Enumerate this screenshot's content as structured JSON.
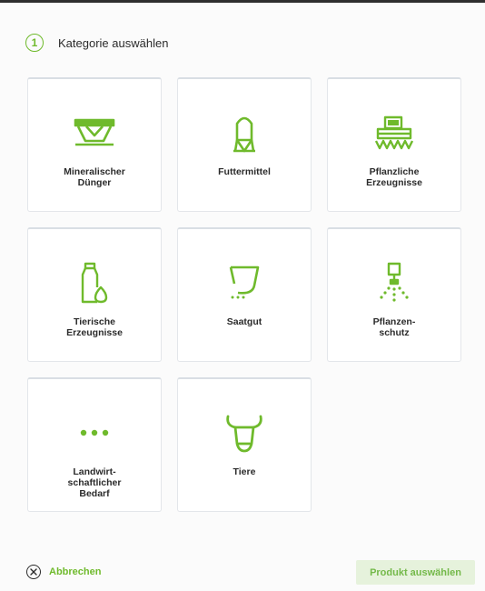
{
  "header": {
    "step_number": "1",
    "title": "Kategorie auswählen"
  },
  "categories": [
    {
      "label": "Mineralischer\nDünger",
      "icon": "fertilizer-spreader-icon"
    },
    {
      "label": "Futtermittel",
      "icon": "feed-silo-icon"
    },
    {
      "label": "Pflanzliche\nErzeugnisse",
      "icon": "combine-harvester-icon"
    },
    {
      "label": "Tierische\nErzeugnisse",
      "icon": "milk-egg-icon"
    },
    {
      "label": "Saatgut",
      "icon": "seed-bag-icon"
    },
    {
      "label": "Pflanzen-\nschutz",
      "icon": "sprayer-nozzle-icon"
    },
    {
      "label": "Landwirt-\nschaftlicher\nBedarf",
      "icon": "more-dots-icon"
    },
    {
      "label": "Tiere",
      "icon": "cow-head-icon"
    }
  ],
  "footer": {
    "cancel_label": "Abbrechen",
    "select_label": "Produkt auswählen"
  },
  "colors": {
    "accent": "#6fba2c",
    "button_bg": "#e6f2dc"
  }
}
